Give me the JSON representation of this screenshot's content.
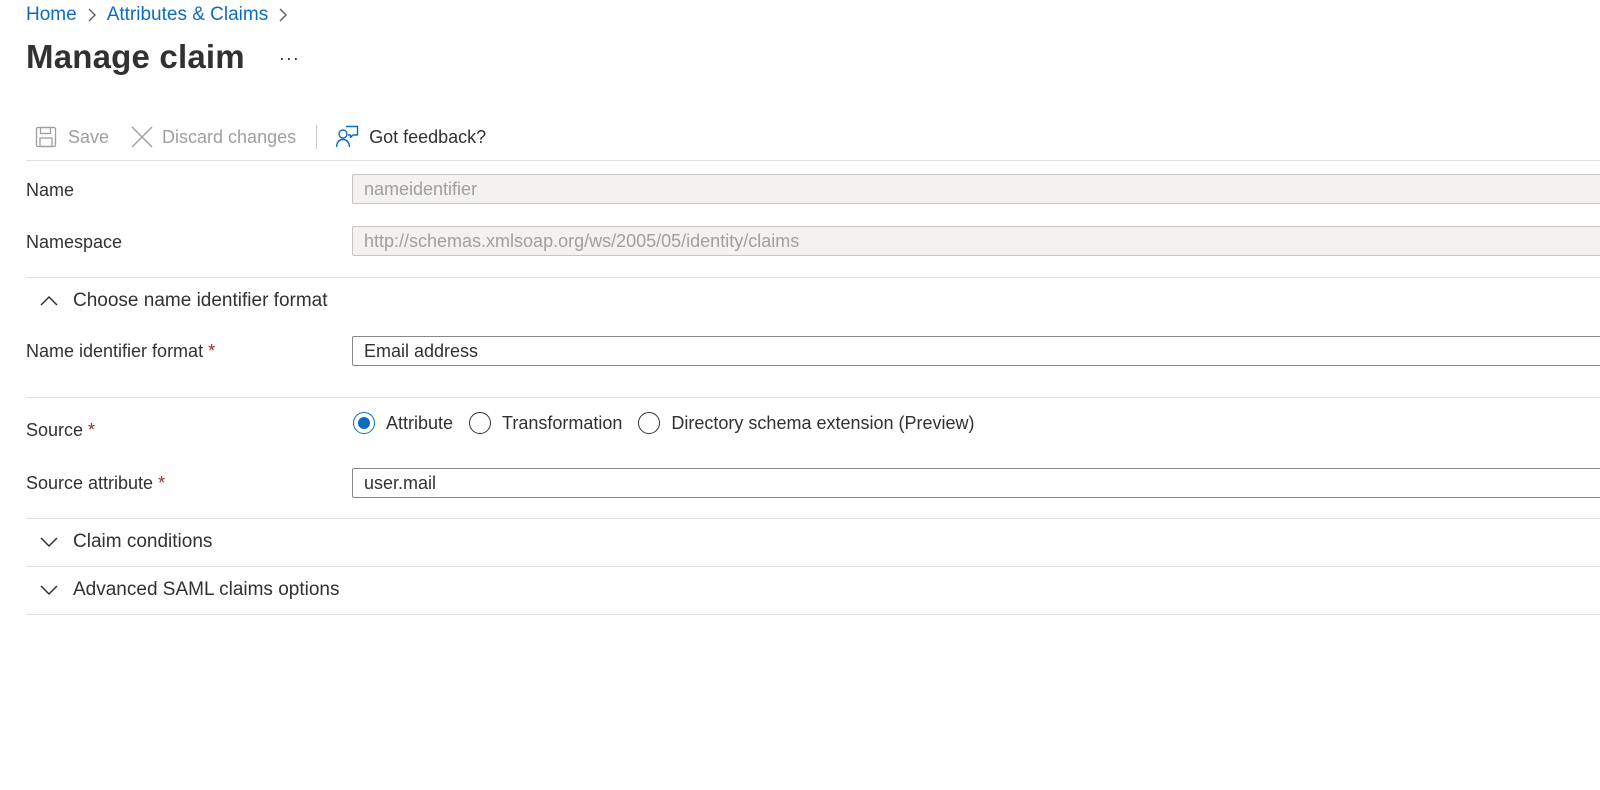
{
  "breadcrumb": {
    "home": "Home",
    "attributes_claims": "Attributes & Claims"
  },
  "page": {
    "title": "Manage claim",
    "more_label": "···"
  },
  "toolbar": {
    "save_label": "Save",
    "discard_label": "Discard changes",
    "feedback_label": "Got feedback?"
  },
  "form": {
    "name": {
      "label": "Name",
      "value": "nameidentifier",
      "disabled": true
    },
    "namespace": {
      "label": "Namespace",
      "value": "http://schemas.xmlsoap.org/ws/2005/05/identity/claims",
      "disabled": true
    },
    "name_id_section": {
      "label": "Choose name identifier format",
      "expanded": true
    },
    "name_id_format": {
      "label": "Name identifier format",
      "required_mark": "*",
      "value": "Email address"
    },
    "source": {
      "label": "Source",
      "required_mark": "*",
      "options": [
        {
          "label": "Attribute",
          "checked": true
        },
        {
          "label": "Transformation",
          "checked": false
        },
        {
          "label": "Directory schema extension (Preview)",
          "checked": false
        }
      ]
    },
    "source_attribute": {
      "label": "Source attribute",
      "required_mark": "*",
      "value": "user.mail"
    },
    "claim_conditions": {
      "label": "Claim conditions",
      "expanded": false
    },
    "advanced_saml": {
      "label": "Advanced SAML claims options",
      "expanded": false
    }
  },
  "colors": {
    "accent": "#0f6cbd",
    "required": "#a4262c",
    "disabled_text": "#a19f9d",
    "disabled_bg": "#f3f2f1"
  }
}
